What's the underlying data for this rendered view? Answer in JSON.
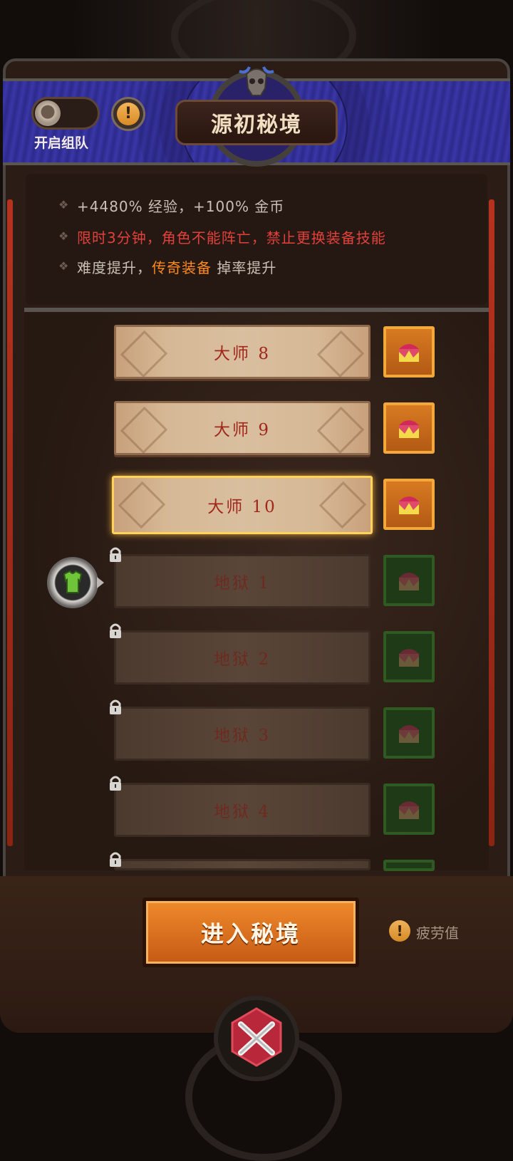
{
  "header": {
    "title": "源初秘境",
    "team_toggle_label": "开启组队"
  },
  "info": {
    "line1": "+4480% 经验，+100% 金币",
    "line2": "限时3分钟，角色不能阵亡，禁止更换装备技能",
    "line3_prefix": "难度提升，",
    "line3_highlight": "传奇装备",
    "line3_suffix": " 掉率提升"
  },
  "levels": [
    {
      "label": "大师 8",
      "state": "unlocked"
    },
    {
      "label": "大师 9",
      "state": "unlocked"
    },
    {
      "label": "大师 10",
      "state": "selected"
    },
    {
      "label": "地狱 1",
      "state": "locked"
    },
    {
      "label": "地狱 2",
      "state": "locked"
    },
    {
      "label": "地狱 3",
      "state": "locked"
    },
    {
      "label": "地狱 4",
      "state": "locked"
    }
  ],
  "footer": {
    "enter_label": "进入秘境",
    "fatigue_label": "疲劳值"
  },
  "colors": {
    "accent_orange": "#f08a2c",
    "danger_red": "#e2413b",
    "highlight_orange": "#ff8a1e",
    "banner_blue": "#3a37a8"
  },
  "icons": [
    "toggle-knob-icon",
    "info-icon",
    "skull-icon",
    "chest-icon",
    "lock-icon",
    "armor-icon",
    "close-icon"
  ]
}
